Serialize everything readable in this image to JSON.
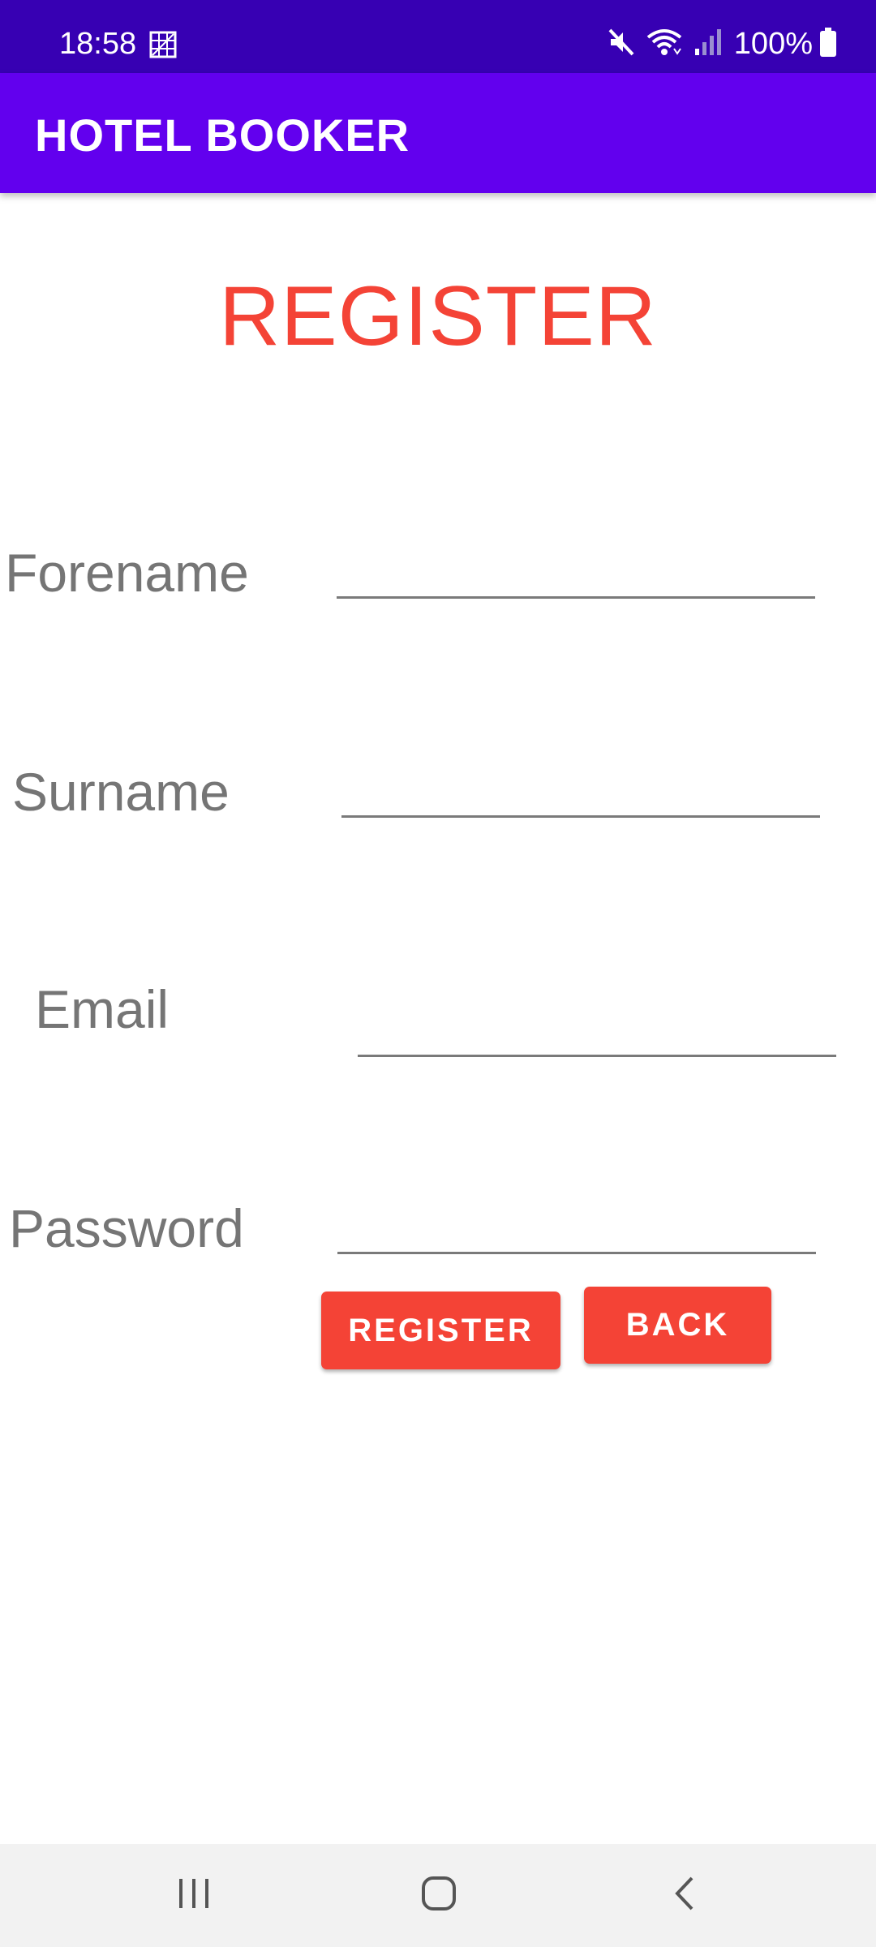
{
  "status_bar": {
    "time": "18:58",
    "battery": "100%",
    "icons": [
      "gallery-icon",
      "mute-icon",
      "wifi-icon",
      "signal-icon",
      "battery-icon"
    ]
  },
  "app_bar": {
    "title": "HOTEL BOOKER"
  },
  "page": {
    "title": "REGISTER"
  },
  "form": {
    "forename": {
      "label": "Forename",
      "value": ""
    },
    "surname": {
      "label": "Surname",
      "value": ""
    },
    "email": {
      "label": "Email",
      "value": ""
    },
    "password": {
      "label": "Password",
      "value": ""
    }
  },
  "buttons": {
    "register": "REGISTER",
    "back": "BACK"
  },
  "nav_bar": {
    "icons": [
      "recents-icon",
      "home-icon",
      "back-icon"
    ]
  },
  "colors": {
    "status_bar": "#3700B3",
    "app_bar": "#6200EE",
    "accent": "#F44336",
    "label_text": "#757575",
    "nav_bar": "#F2F2F2"
  }
}
